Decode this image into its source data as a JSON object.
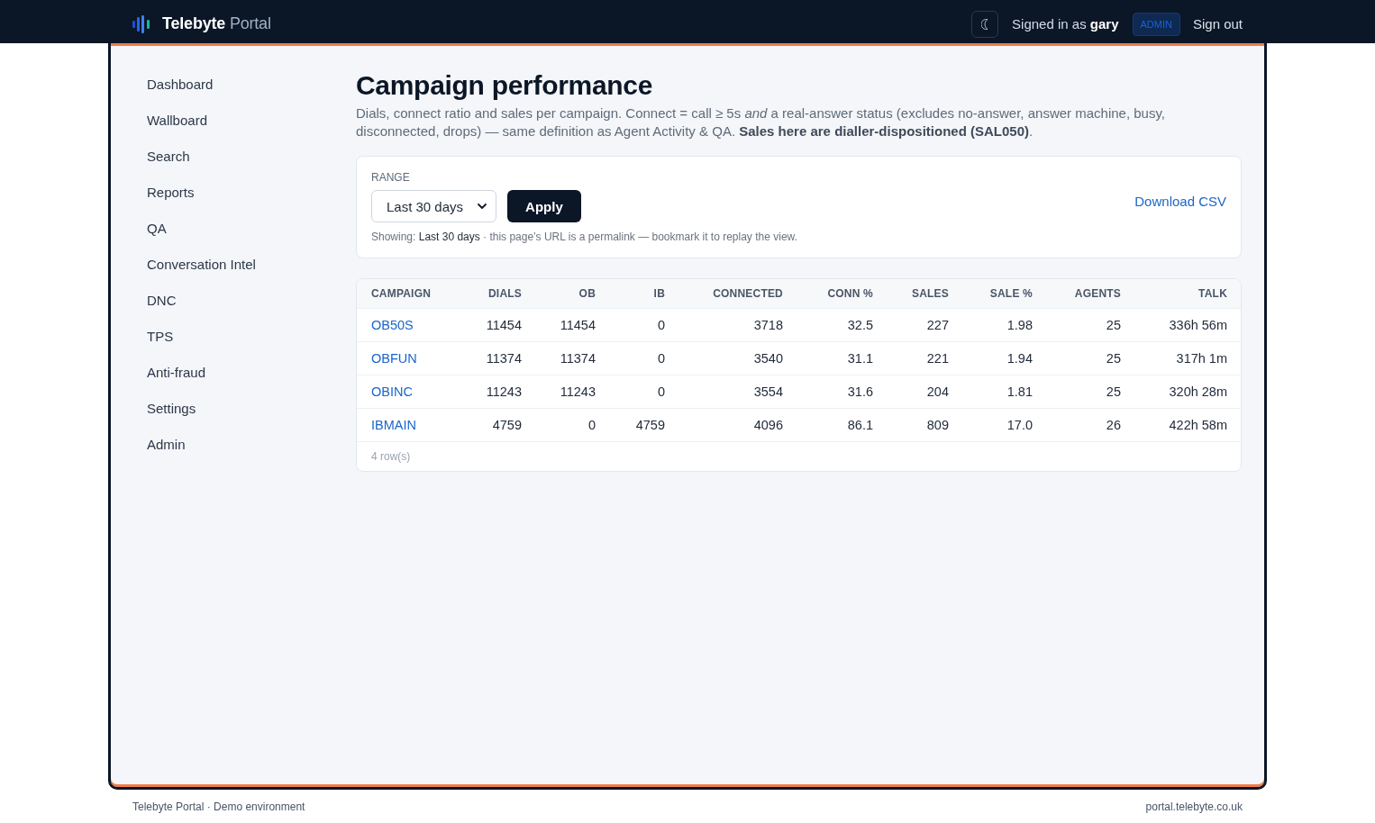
{
  "header": {
    "logo": "**Telebyte** Portal",
    "signed_in": "Signed in as **gary**",
    "role_badge": "ADMIN",
    "sign_out": "Sign out"
  },
  "sidebar": {
    "items": [
      "Dashboard",
      "Wallboard",
      "Search",
      "Reports",
      "QA",
      "Conversation Intel",
      "DNC",
      "TPS",
      "Anti-fraud",
      "Settings",
      "Admin"
    ]
  },
  "page": {
    "title": "Campaign performance",
    "description": "Dials, connect ratio and sales per campaign. Connect = call ≥ 5s *and* a real-answer status (excludes no-answer, answer machine, busy, disconnected, drops) — same definition as Agent Activity & QA. **Sales here are dialler-dispositioned (SAL050)**."
  },
  "filters": {
    "range_label": "RANGE",
    "range_value": "Last 30 days",
    "apply_button": "Apply",
    "download_link": "Download CSV",
    "showing_note": "Showing: **Last 30 days** · this page’s URL is a permalink — bookmark it to replay the view."
  },
  "table": {
    "columns": [
      "CAMPAIGN",
      "DIALS",
      "OB",
      "IB",
      "CONNECTED",
      "CONN %",
      "SALES",
      "SALE %",
      "AGENTS",
      "TALK"
    ],
    "rows": [
      [
        "OB50S",
        "11454",
        "11454",
        "0",
        "3718",
        "32.5",
        "227",
        "1.98",
        "25",
        "336h 56m"
      ],
      [
        "OBFUN",
        "11374",
        "11374",
        "0",
        "3540",
        "31.1",
        "221",
        "1.94",
        "25",
        "317h 1m"
      ],
      [
        "OBINC",
        "11243",
        "11243",
        "0",
        "3554",
        "31.6",
        "204",
        "1.81",
        "25",
        "320h 28m"
      ],
      [
        "IBMAIN",
        "4759",
        "0",
        "4759",
        "4096",
        "86.1",
        "809",
        "17.0",
        "26",
        "422h 58m"
      ]
    ],
    "row_count": "4 row(s)"
  },
  "footer": {
    "left": "Telebyte Portal · Demo environment",
    "right": "portal.telebyte.co.uk"
  }
}
